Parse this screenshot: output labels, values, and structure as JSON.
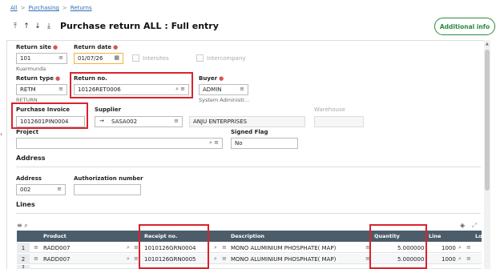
{
  "breadcrumb": [
    "All",
    "Purchasing",
    "Returns"
  ],
  "title": "Purchase return ALL : Full entry",
  "additional_info": "Additional info",
  "form": {
    "return_site": {
      "label": "Return site",
      "value": "101",
      "sub": "Kuarmunda"
    },
    "return_date": {
      "label": "Return date",
      "value": "01/07/26"
    },
    "intersites": "Intersites",
    "intercompany": "Intercompany",
    "return_type": {
      "label": "Return type",
      "value": "RETM",
      "sub": "RETURN"
    },
    "return_no": {
      "label": "Return no.",
      "value": "10126RET0006"
    },
    "buyer": {
      "label": "Buyer",
      "value": "ADMIN",
      "sub": "System Administr..."
    },
    "purchase_invoice": {
      "label": "Purchase Invoice",
      "value": "1012601PIN0004"
    },
    "supplier": {
      "label": "Supplier",
      "value": "SASA002",
      "name": "ANJU ENTERPRISES"
    },
    "warehouse": {
      "label": "Warehouse",
      "value": ""
    },
    "project": {
      "label": "Project",
      "value": ""
    },
    "signed_flag": {
      "label": "Signed Flag",
      "value": "No"
    }
  },
  "address_section": {
    "title": "Address",
    "address": {
      "label": "Address",
      "value": "002"
    },
    "authorization": {
      "label": "Authorization number",
      "value": ""
    }
  },
  "lines": {
    "title": "Lines",
    "columns": [
      "Product",
      "Receipt no.",
      "Description",
      "Quantity",
      "Line",
      "Lo"
    ],
    "rows": [
      {
        "num": "1",
        "product": "RADD007",
        "receipt": "1010126GRN0004",
        "description": "MONO ALUMINIUM PHOSPHATE( MAP)",
        "quantity": "5.000000",
        "line": "1000"
      },
      {
        "num": "2",
        "product": "RADD007",
        "receipt": "1010126GRN0005",
        "description": "MONO ALUMINIUM PHOSPHATE( MAP)",
        "quantity": "5.000000",
        "line": "1000"
      },
      {
        "num": "3",
        "product": "",
        "receipt": "",
        "description": "",
        "quantity": "",
        "line": ""
      }
    ]
  },
  "colors": {
    "accent": "#2a8a3d",
    "highlight": "#d9232d",
    "table_header": "#4b5d6a",
    "link": "#2f6fb3"
  }
}
